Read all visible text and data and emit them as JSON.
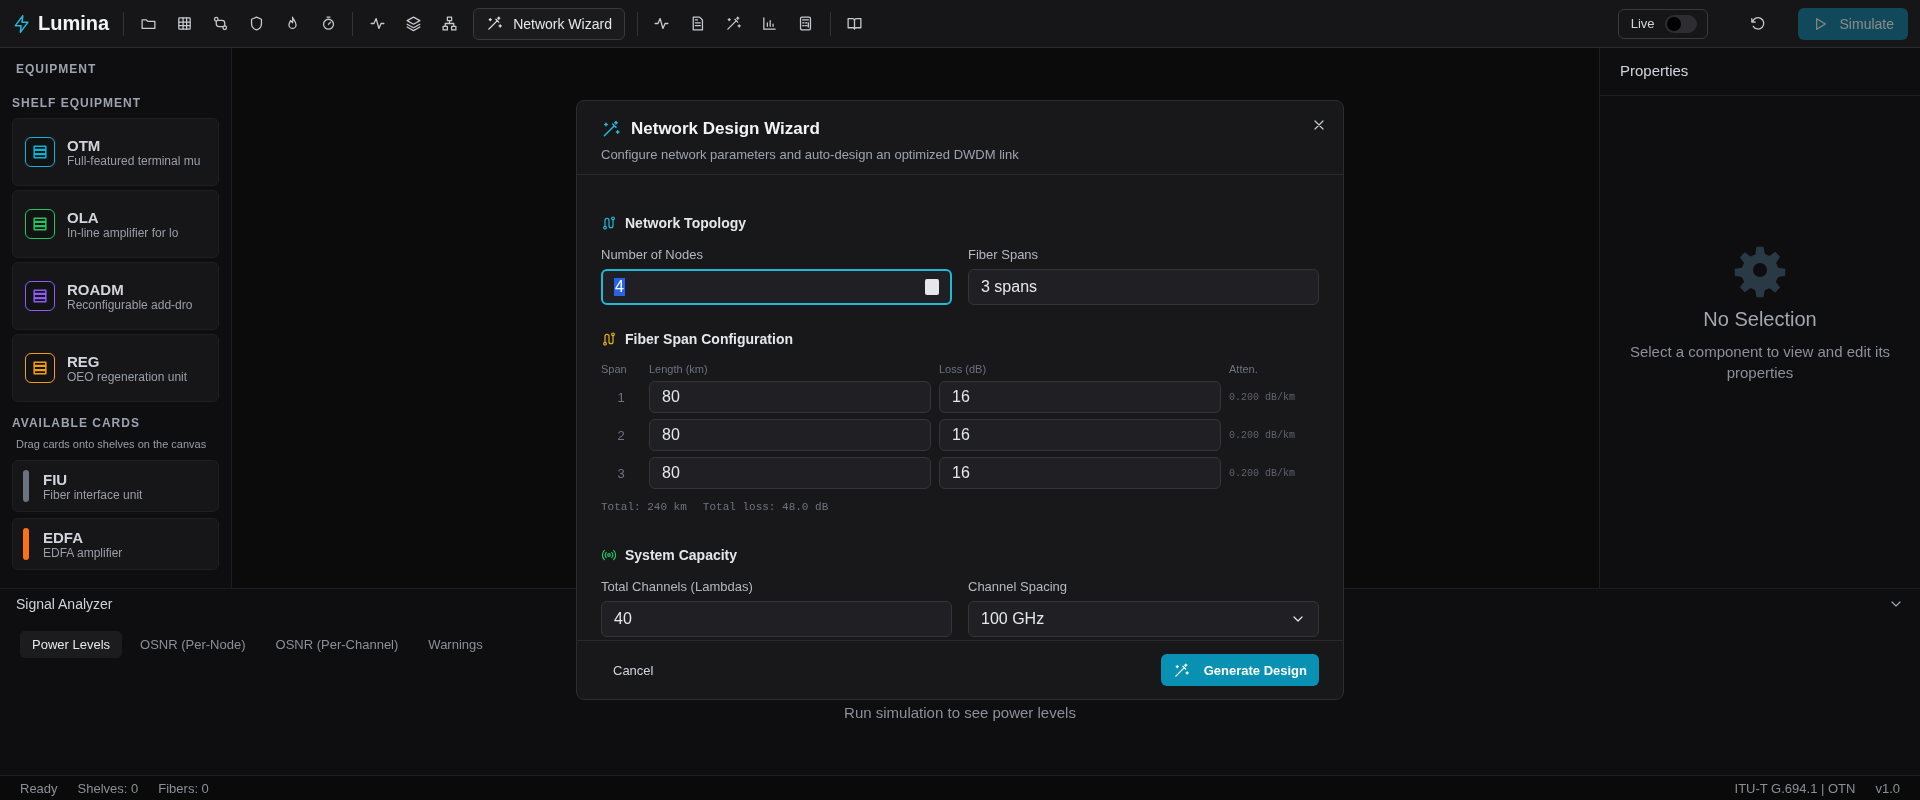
{
  "app": {
    "name": "Lumina"
  },
  "toolbar": {
    "wizard_button": "Network Wizard",
    "live_toggle": {
      "label": "Live",
      "on": false
    },
    "simulate_button": {
      "label": "Simulate",
      "disabled": true
    }
  },
  "sidebar": {
    "title": "EQUIPMENT",
    "shelf_heading": "SHELF EQUIPMENT",
    "shelves": [
      {
        "name": "OTM",
        "description": "Full-featured terminal mu",
        "color": "#06b6d4"
      },
      {
        "name": "OLA",
        "description": "In-line amplifier for lo",
        "color": "#22c55e"
      },
      {
        "name": "ROADM",
        "description": "Reconfigurable add-dro",
        "color": "#8b5cf6"
      },
      {
        "name": "REG",
        "description": "OEO regeneration unit",
        "color": "#f59e0b"
      }
    ],
    "cards_heading": "AVAILABLE CARDS",
    "cards_hint": "Drag cards onto shelves on the canvas",
    "cards": [
      {
        "name": "FIU",
        "description": "Fiber interface unit",
        "color": "#6b7280"
      },
      {
        "name": "EDFA",
        "description": "EDFA amplifier",
        "color": "#f97316"
      }
    ]
  },
  "properties": {
    "title": "Properties",
    "empty_title": "No Selection",
    "empty_text": "Select a component to view and edit its properties"
  },
  "signal_analyzer": {
    "title": "Signal Analyzer",
    "tabs": [
      {
        "label": "Power Levels",
        "selected": true
      },
      {
        "label": "OSNR (Per-Node)",
        "selected": false
      },
      {
        "label": "OSNR (Per-Channel)",
        "selected": false
      },
      {
        "label": "Warnings",
        "selected": false
      }
    ],
    "empty_text": "Run simulation to see power levels"
  },
  "status_bar": {
    "left": [
      "Ready",
      "Shelves: 0",
      "Fibers: 0"
    ],
    "right": [
      "ITU-T G.694.1 | OTN",
      "v1.0"
    ]
  },
  "dialog": {
    "title": "Network Design Wizard",
    "subtitle": "Configure network parameters and auto-design an optimized DWDM link",
    "topology": {
      "title": "Network Topology",
      "nodes_label": "Number of Nodes",
      "nodes_value": "4",
      "spans_label": "Fiber Spans",
      "spans_value": "3 spans"
    },
    "span_config": {
      "title": "Fiber Span Configuration",
      "columns": [
        "Span",
        "Length (km)",
        "Loss (dB)",
        "Atten."
      ],
      "rows": [
        {
          "span": "1",
          "length": "80",
          "loss": "16",
          "atten": "0.200 dB/km"
        },
        {
          "span": "2",
          "length": "80",
          "loss": "16",
          "atten": "0.200 dB/km"
        },
        {
          "span": "3",
          "length": "80",
          "loss": "16",
          "atten": "0.200 dB/km"
        }
      ],
      "total_length": "Total: 240 km",
      "total_loss": "Total loss: 48.0 dB"
    },
    "capacity": {
      "title": "System Capacity",
      "channels_label": "Total Channels (Lambdas)",
      "channels_value": "40",
      "spacing_label": "Channel Spacing",
      "spacing_value": "100 GHz"
    },
    "cancel_button": "Cancel",
    "generate_button": "Generate Design"
  }
}
